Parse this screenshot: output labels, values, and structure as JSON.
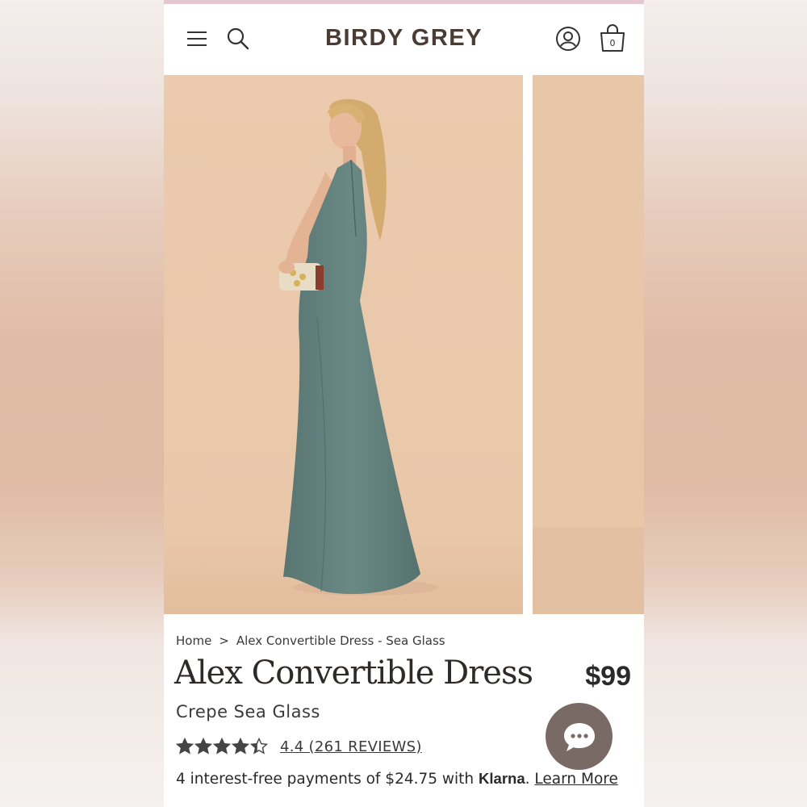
{
  "header": {
    "logo": "BIRDY GREY",
    "bag_count": "0",
    "icons": [
      "hamburger-menu-icon",
      "search-icon",
      "account-icon",
      "shopping-bag-icon"
    ]
  },
  "gallery": {
    "images": [
      "model-wearing-sea-glass-dress",
      "next-product-image-partial"
    ]
  },
  "breadcrumb": {
    "home": "Home",
    "separator": ">",
    "current": "Alex Convertible Dress - Sea Glass"
  },
  "product": {
    "title": "Alex Convertible Dress",
    "price": "$99",
    "subtitle": "Crepe Sea Glass",
    "rating_value": 4.4,
    "rating_max": 5,
    "reviews_label": "4.4 (261 REVIEWS)"
  },
  "payments": {
    "prefix": "4 interest-free payments of $24.75 with ",
    "provider": "Klarna",
    "suffix": ". ",
    "learn_more": "Learn More"
  },
  "chat": {
    "icon": "chat-bubble-icon"
  },
  "colors": {
    "accent_bar": "#e6c6cf",
    "logo": "#4a3b33",
    "backdrop": "#e9c7a9",
    "dress": "#5f7d78",
    "chat_button": "#7a6a66"
  }
}
